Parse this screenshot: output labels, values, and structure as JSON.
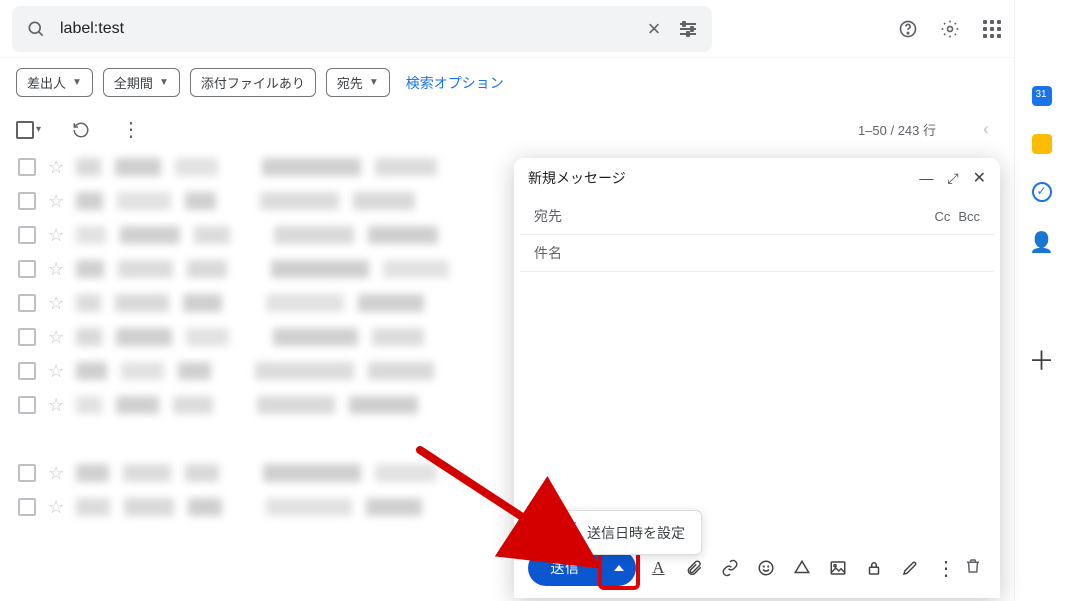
{
  "search": {
    "value": "label:test"
  },
  "chips": {
    "from": "差出人",
    "period": "全期間",
    "attachment": "添付ファイルあり",
    "to": "宛先",
    "options": "検索オプション"
  },
  "toolbar": {
    "page_indicator": "1–50 / 243 行"
  },
  "compose": {
    "title": "新規メッセージ",
    "to_label": "宛先",
    "cc": "Cc",
    "bcc": "Bcc",
    "subject_label": "件名",
    "send": "送信",
    "schedule_popup": "送信日時を設定"
  },
  "list_rows": 10
}
